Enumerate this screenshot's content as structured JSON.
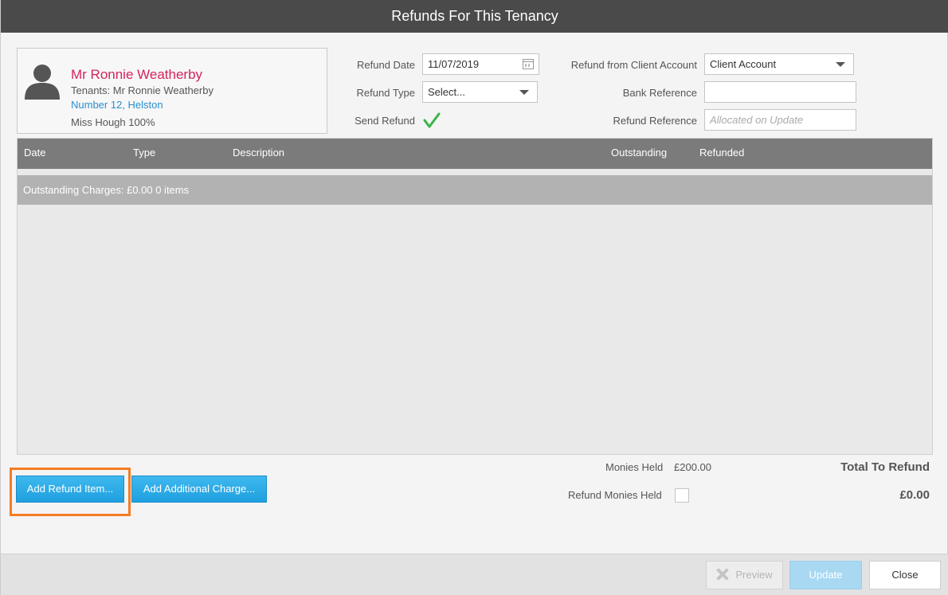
{
  "window": {
    "title": "Refunds For This Tenancy"
  },
  "tenant": {
    "name": "Mr Ronnie Weatherby",
    "tenants_line": "Tenants: Mr Ronnie Weatherby",
    "property": "Number 12, Helston",
    "landlord_share": "Miss Hough 100%"
  },
  "form": {
    "refund_date_label": "Refund Date",
    "refund_date_value": "11/07/2019",
    "refund_type_label": "Refund Type",
    "refund_type_value": "Select...",
    "send_refund_label": "Send Refund",
    "send_refund_checked": true,
    "client_account_label": "Refund from Client Account",
    "client_account_value": "Client Account",
    "bank_reference_label": "Bank Reference",
    "bank_reference_value": "",
    "refund_reference_label": "Refund Reference",
    "refund_reference_placeholder": "Allocated on Update"
  },
  "grid": {
    "columns": [
      "Date",
      "Type",
      "Description",
      "Outstanding",
      "Refunded"
    ],
    "group_label": "Outstanding Charges: £0.00 0 items",
    "rows": []
  },
  "actions": {
    "add_refund_item": "Add Refund Item...",
    "add_additional_charge": "Add Additional Charge..."
  },
  "summary": {
    "monies_held_label": "Monies Held",
    "monies_held_value": "£200.00",
    "refund_monies_held_label": "Refund Monies Held",
    "refund_monies_held_checked": false,
    "total_label": "Total To Refund",
    "total_value": "£0.00"
  },
  "footer": {
    "preview": "Preview",
    "update": "Update",
    "close": "Close"
  },
  "colors": {
    "accent": "#1fa0e0",
    "tenant_name": "#d2245b",
    "link": "#2a8fd0",
    "highlight": "#f57c22"
  }
}
